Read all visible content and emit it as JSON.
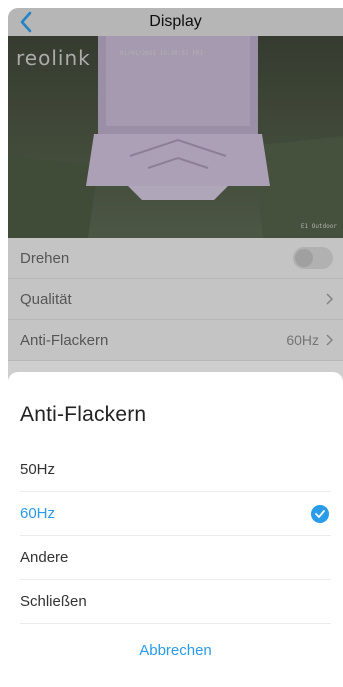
{
  "nav": {
    "title": "Display"
  },
  "video": {
    "logo": "reolink",
    "osd_top": "01/01/2021 10:20:51 FRI",
    "osd_bottom": "E1 Outdoor"
  },
  "settings": {
    "rotate_label": "Drehen",
    "quality_label": "Qualität",
    "antiflicker_label": "Anti-Flackern",
    "antiflicker_value": "60Hz"
  },
  "sheet": {
    "title": "Anti-Flackern",
    "options": [
      {
        "label": "50Hz"
      },
      {
        "label": "60Hz"
      },
      {
        "label": "Andere"
      },
      {
        "label": "Schließen"
      }
    ],
    "selected_option": "60Hz",
    "cancel_label": "Abbrechen"
  },
  "colors": {
    "accent": "#2a9be8",
    "nav_bg": "#d6d6d6"
  }
}
